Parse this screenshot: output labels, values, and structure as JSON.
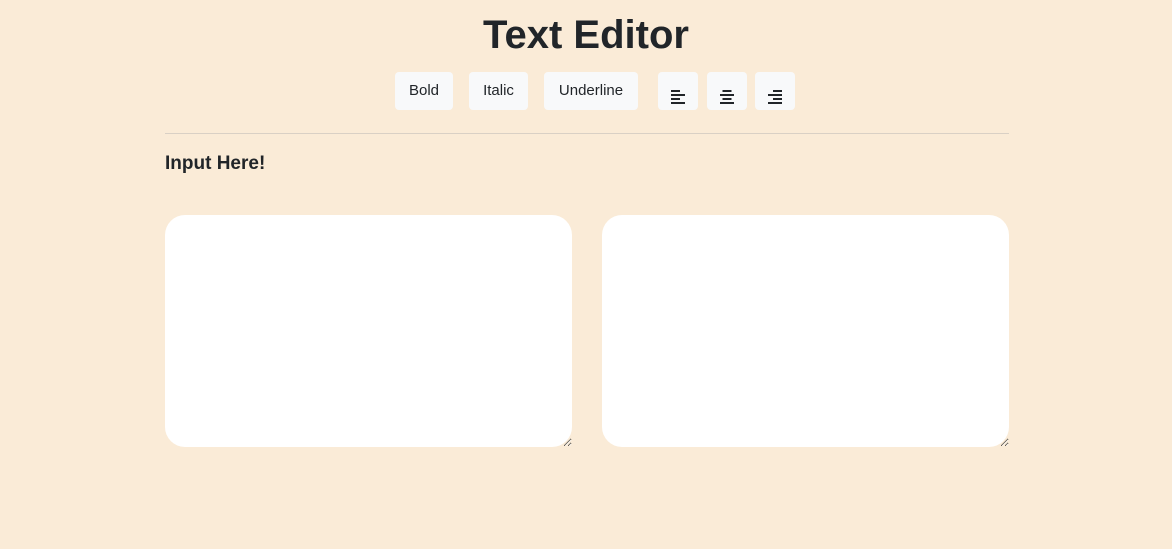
{
  "header": {
    "title": "Text Editor"
  },
  "toolbar": {
    "bold_label": "Bold",
    "italic_label": "Italic",
    "underline_label": "Underline",
    "align_left_icon": "align-left-icon",
    "align_center_icon": "align-center-icon",
    "align_right_icon": "align-right-icon"
  },
  "editor": {
    "label": "Input Here!",
    "input_value": "",
    "output_value": ""
  },
  "colors": {
    "background": "#faebd7",
    "button_bg": "#f8f9fa",
    "text": "#212529",
    "pane_bg": "#ffffff"
  }
}
